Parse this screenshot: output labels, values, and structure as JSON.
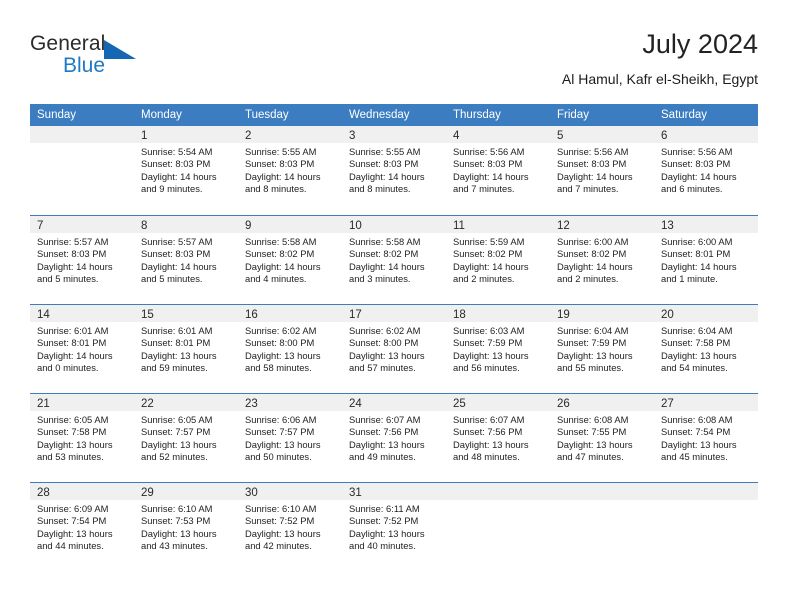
{
  "brand": {
    "name_part1": "General",
    "name_part2": "Blue",
    "accent_color": "#1567b3"
  },
  "header": {
    "title": "July 2024",
    "subtitle": "Al Hamul, Kafr el-Sheikh, Egypt"
  },
  "calendar": {
    "header_color": "#3b7dc0",
    "day_band_color": "#f0f0f0",
    "weekdays": [
      "Sunday",
      "Monday",
      "Tuesday",
      "Wednesday",
      "Thursday",
      "Friday",
      "Saturday"
    ],
    "weeks": [
      [
        {
          "day": "",
          "sunrise": "",
          "sunset": "",
          "daylight1": "",
          "daylight2": ""
        },
        {
          "day": "1",
          "sunrise": "Sunrise: 5:54 AM",
          "sunset": "Sunset: 8:03 PM",
          "daylight1": "Daylight: 14 hours",
          "daylight2": "and 9 minutes."
        },
        {
          "day": "2",
          "sunrise": "Sunrise: 5:55 AM",
          "sunset": "Sunset: 8:03 PM",
          "daylight1": "Daylight: 14 hours",
          "daylight2": "and 8 minutes."
        },
        {
          "day": "3",
          "sunrise": "Sunrise: 5:55 AM",
          "sunset": "Sunset: 8:03 PM",
          "daylight1": "Daylight: 14 hours",
          "daylight2": "and 8 minutes."
        },
        {
          "day": "4",
          "sunrise": "Sunrise: 5:56 AM",
          "sunset": "Sunset: 8:03 PM",
          "daylight1": "Daylight: 14 hours",
          "daylight2": "and 7 minutes."
        },
        {
          "day": "5",
          "sunrise": "Sunrise: 5:56 AM",
          "sunset": "Sunset: 8:03 PM",
          "daylight1": "Daylight: 14 hours",
          "daylight2": "and 7 minutes."
        },
        {
          "day": "6",
          "sunrise": "Sunrise: 5:56 AM",
          "sunset": "Sunset: 8:03 PM",
          "daylight1": "Daylight: 14 hours",
          "daylight2": "and 6 minutes."
        }
      ],
      [
        {
          "day": "7",
          "sunrise": "Sunrise: 5:57 AM",
          "sunset": "Sunset: 8:03 PM",
          "daylight1": "Daylight: 14 hours",
          "daylight2": "and 5 minutes."
        },
        {
          "day": "8",
          "sunrise": "Sunrise: 5:57 AM",
          "sunset": "Sunset: 8:03 PM",
          "daylight1": "Daylight: 14 hours",
          "daylight2": "and 5 minutes."
        },
        {
          "day": "9",
          "sunrise": "Sunrise: 5:58 AM",
          "sunset": "Sunset: 8:02 PM",
          "daylight1": "Daylight: 14 hours",
          "daylight2": "and 4 minutes."
        },
        {
          "day": "10",
          "sunrise": "Sunrise: 5:58 AM",
          "sunset": "Sunset: 8:02 PM",
          "daylight1": "Daylight: 14 hours",
          "daylight2": "and 3 minutes."
        },
        {
          "day": "11",
          "sunrise": "Sunrise: 5:59 AM",
          "sunset": "Sunset: 8:02 PM",
          "daylight1": "Daylight: 14 hours",
          "daylight2": "and 2 minutes."
        },
        {
          "day": "12",
          "sunrise": "Sunrise: 6:00 AM",
          "sunset": "Sunset: 8:02 PM",
          "daylight1": "Daylight: 14 hours",
          "daylight2": "and 2 minutes."
        },
        {
          "day": "13",
          "sunrise": "Sunrise: 6:00 AM",
          "sunset": "Sunset: 8:01 PM",
          "daylight1": "Daylight: 14 hours",
          "daylight2": "and 1 minute."
        }
      ],
      [
        {
          "day": "14",
          "sunrise": "Sunrise: 6:01 AM",
          "sunset": "Sunset: 8:01 PM",
          "daylight1": "Daylight: 14 hours",
          "daylight2": "and 0 minutes."
        },
        {
          "day": "15",
          "sunrise": "Sunrise: 6:01 AM",
          "sunset": "Sunset: 8:01 PM",
          "daylight1": "Daylight: 13 hours",
          "daylight2": "and 59 minutes."
        },
        {
          "day": "16",
          "sunrise": "Sunrise: 6:02 AM",
          "sunset": "Sunset: 8:00 PM",
          "daylight1": "Daylight: 13 hours",
          "daylight2": "and 58 minutes."
        },
        {
          "day": "17",
          "sunrise": "Sunrise: 6:02 AM",
          "sunset": "Sunset: 8:00 PM",
          "daylight1": "Daylight: 13 hours",
          "daylight2": "and 57 minutes."
        },
        {
          "day": "18",
          "sunrise": "Sunrise: 6:03 AM",
          "sunset": "Sunset: 7:59 PM",
          "daylight1": "Daylight: 13 hours",
          "daylight2": "and 56 minutes."
        },
        {
          "day": "19",
          "sunrise": "Sunrise: 6:04 AM",
          "sunset": "Sunset: 7:59 PM",
          "daylight1": "Daylight: 13 hours",
          "daylight2": "and 55 minutes."
        },
        {
          "day": "20",
          "sunrise": "Sunrise: 6:04 AM",
          "sunset": "Sunset: 7:58 PM",
          "daylight1": "Daylight: 13 hours",
          "daylight2": "and 54 minutes."
        }
      ],
      [
        {
          "day": "21",
          "sunrise": "Sunrise: 6:05 AM",
          "sunset": "Sunset: 7:58 PM",
          "daylight1": "Daylight: 13 hours",
          "daylight2": "and 53 minutes."
        },
        {
          "day": "22",
          "sunrise": "Sunrise: 6:05 AM",
          "sunset": "Sunset: 7:57 PM",
          "daylight1": "Daylight: 13 hours",
          "daylight2": "and 52 minutes."
        },
        {
          "day": "23",
          "sunrise": "Sunrise: 6:06 AM",
          "sunset": "Sunset: 7:57 PM",
          "daylight1": "Daylight: 13 hours",
          "daylight2": "and 50 minutes."
        },
        {
          "day": "24",
          "sunrise": "Sunrise: 6:07 AM",
          "sunset": "Sunset: 7:56 PM",
          "daylight1": "Daylight: 13 hours",
          "daylight2": "and 49 minutes."
        },
        {
          "day": "25",
          "sunrise": "Sunrise: 6:07 AM",
          "sunset": "Sunset: 7:56 PM",
          "daylight1": "Daylight: 13 hours",
          "daylight2": "and 48 minutes."
        },
        {
          "day": "26",
          "sunrise": "Sunrise: 6:08 AM",
          "sunset": "Sunset: 7:55 PM",
          "daylight1": "Daylight: 13 hours",
          "daylight2": "and 47 minutes."
        },
        {
          "day": "27",
          "sunrise": "Sunrise: 6:08 AM",
          "sunset": "Sunset: 7:54 PM",
          "daylight1": "Daylight: 13 hours",
          "daylight2": "and 45 minutes."
        }
      ],
      [
        {
          "day": "28",
          "sunrise": "Sunrise: 6:09 AM",
          "sunset": "Sunset: 7:54 PM",
          "daylight1": "Daylight: 13 hours",
          "daylight2": "and 44 minutes."
        },
        {
          "day": "29",
          "sunrise": "Sunrise: 6:10 AM",
          "sunset": "Sunset: 7:53 PM",
          "daylight1": "Daylight: 13 hours",
          "daylight2": "and 43 minutes."
        },
        {
          "day": "30",
          "sunrise": "Sunrise: 6:10 AM",
          "sunset": "Sunset: 7:52 PM",
          "daylight1": "Daylight: 13 hours",
          "daylight2": "and 42 minutes."
        },
        {
          "day": "31",
          "sunrise": "Sunrise: 6:11 AM",
          "sunset": "Sunset: 7:52 PM",
          "daylight1": "Daylight: 13 hours",
          "daylight2": "and 40 minutes."
        },
        {
          "day": "",
          "sunrise": "",
          "sunset": "",
          "daylight1": "",
          "daylight2": ""
        },
        {
          "day": "",
          "sunrise": "",
          "sunset": "",
          "daylight1": "",
          "daylight2": ""
        },
        {
          "day": "",
          "sunrise": "",
          "sunset": "",
          "daylight1": "",
          "daylight2": ""
        }
      ]
    ]
  }
}
